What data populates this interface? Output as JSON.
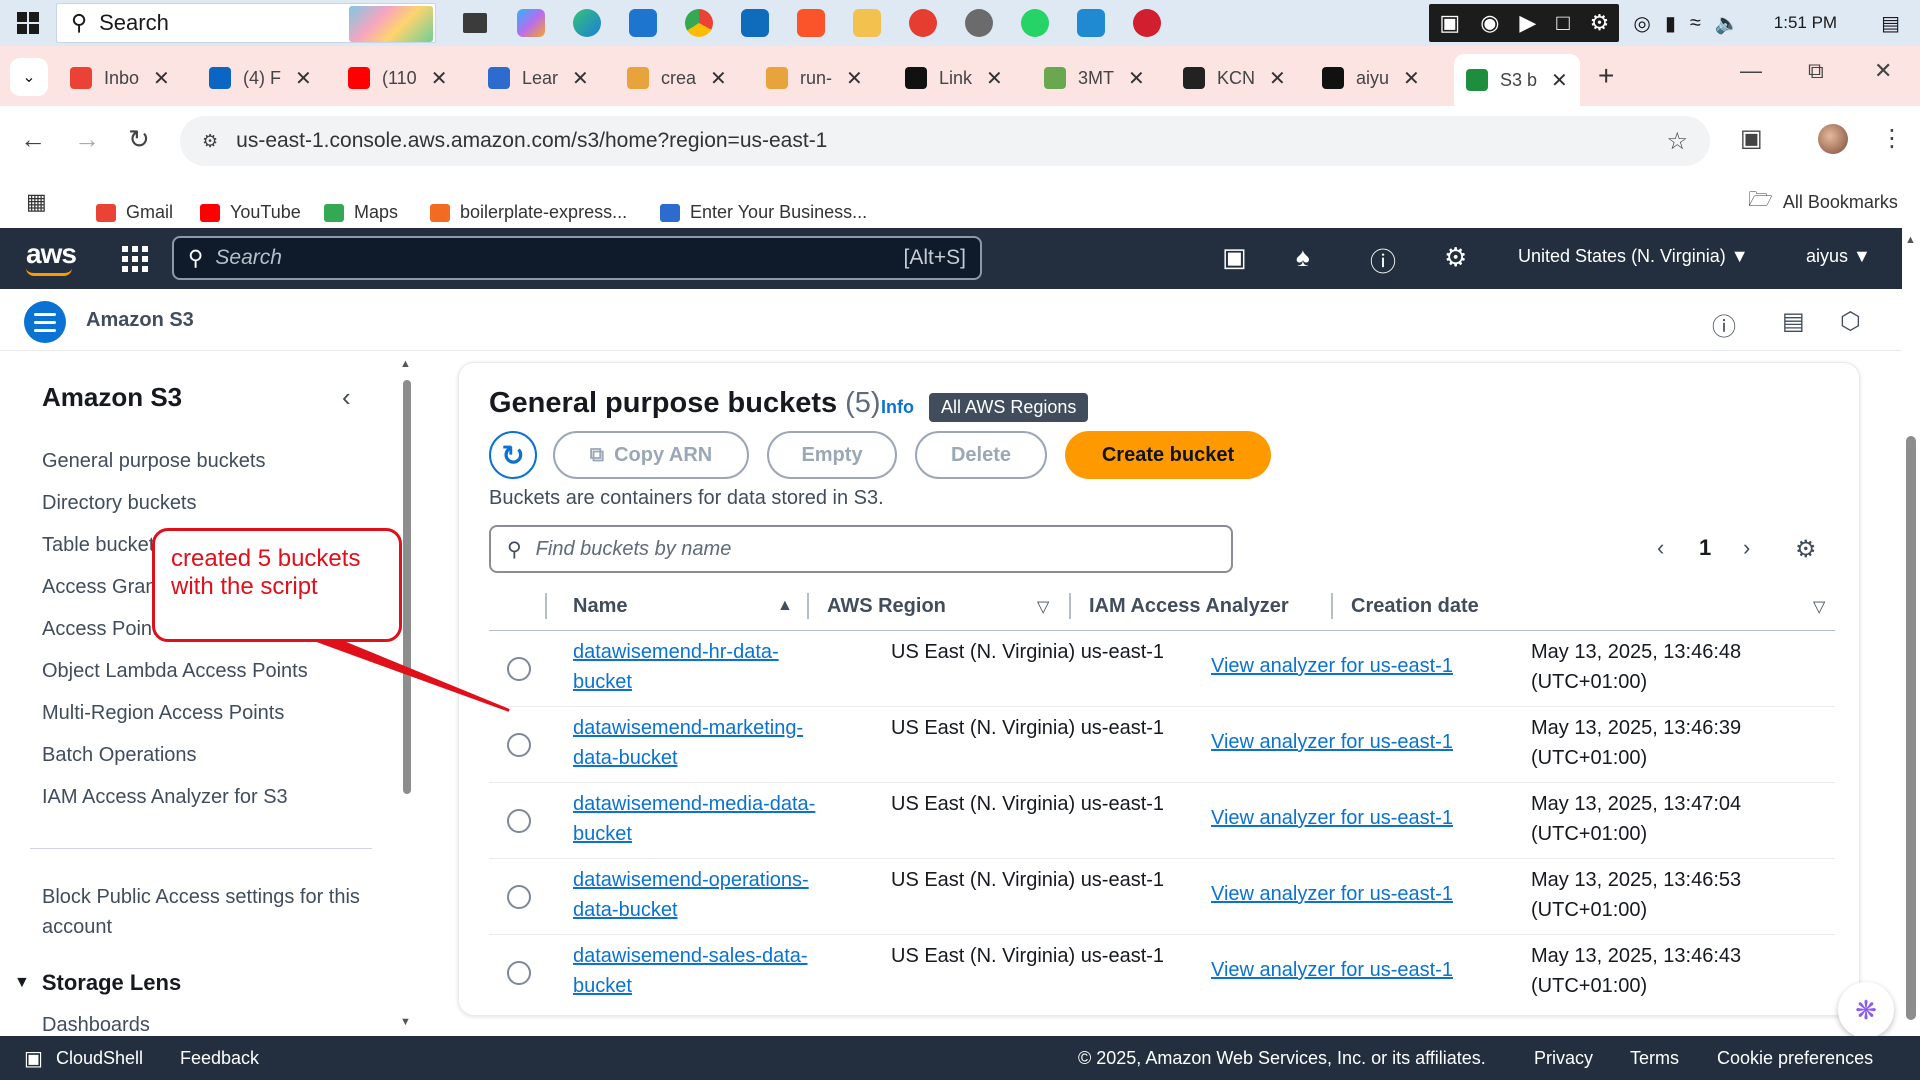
{
  "taskbar": {
    "search_placeholder": "Search",
    "clock": "1:51 PM"
  },
  "browser": {
    "tabs": [
      {
        "label": "Inbo",
        "color": "#ea4335"
      },
      {
        "label": "(4) F",
        "color": "#0a66c2"
      },
      {
        "label": "(110",
        "color": "#ff0000"
      },
      {
        "label": "Lear",
        "color": "#2d6bcf"
      },
      {
        "label": "crea",
        "color": "#e8a33d"
      },
      {
        "label": "run-",
        "color": "#e8a33d"
      },
      {
        "label": "Link",
        "color": "#111111"
      },
      {
        "label": "3MT",
        "color": "#6aa84f"
      },
      {
        "label": "KCN",
        "color": "#222222"
      },
      {
        "label": "aiyu",
        "color": "#111111"
      },
      {
        "label": "S3 b",
        "color": "#1e8e3e"
      }
    ],
    "url": "us-east-1.console.aws.amazon.com/s3/home?region=us-east-1",
    "bookmarks": [
      {
        "label": "Gmail",
        "color": "#ea4335"
      },
      {
        "label": "YouTube",
        "color": "#ff0000"
      },
      {
        "label": "Maps",
        "color": "#34a853"
      },
      {
        "label": "boilerplate-express...",
        "color": "#f26b21"
      },
      {
        "label": "Enter Your Business...",
        "color": "#2d6bcf"
      }
    ],
    "all_bookmarks": "All Bookmarks"
  },
  "aws_nav": {
    "logo": "aws",
    "search_placeholder": "Search",
    "shortcut": "[Alt+S]",
    "region": "United States (N. Virginia) ▼",
    "user": "aiyus ▼"
  },
  "service": {
    "title": "Amazon S3"
  },
  "sidebar": {
    "title": "Amazon S3",
    "items": [
      "General purpose buckets",
      "Directory buckets",
      "Table buckets",
      "Access Grants",
      "Access Points",
      "Object Lambda Access Points",
      "Multi-Region Access Points",
      "Batch Operations",
      "IAM Access Analyzer for S3"
    ],
    "block_public": "Block Public Access settings for this account",
    "section": "Storage Lens",
    "section_item": "Dashboards"
  },
  "annotation": {
    "text": "created 5 buckets with the script"
  },
  "panel": {
    "title": "General purpose buckets",
    "count": "(5)",
    "info": "Info",
    "badge": "All AWS Regions",
    "buttons": {
      "copy_arn": "Copy ARN",
      "empty": "Empty",
      "delete": "Delete",
      "create": "Create bucket"
    },
    "description": "Buckets are containers for data stored in S3.",
    "search_placeholder": "Find buckets by name",
    "page": "1",
    "columns": [
      "Name",
      "AWS Region",
      "IAM Access Analyzer",
      "Creation date"
    ],
    "rows": [
      {
        "name": "datawisemend-hr-data-bucket",
        "region": "US East (N. Virginia) us-east-1",
        "analyzer": "View analyzer for us-east-1",
        "date": "May 13, 2025, 13:46:48 (UTC+01:00)"
      },
      {
        "name": "datawisemend-marketing-data-bucket",
        "region": "US East (N. Virginia) us-east-1",
        "analyzer": "View analyzer for us-east-1",
        "date": "May 13, 2025, 13:46:39 (UTC+01:00)"
      },
      {
        "name": "datawisemend-media-data-bucket",
        "region": "US East (N. Virginia) us-east-1",
        "analyzer": "View analyzer for us-east-1",
        "date": "May 13, 2025, 13:47:04 (UTC+01:00)"
      },
      {
        "name": "datawisemend-operations-data-bucket",
        "region": "US East (N. Virginia) us-east-1",
        "analyzer": "View analyzer for us-east-1",
        "date": "May 13, 2025, 13:46:53 (UTC+01:00)"
      },
      {
        "name": "datawisemend-sales-data-bucket",
        "region": "US East (N. Virginia) us-east-1",
        "analyzer": "View analyzer for us-east-1",
        "date": "May 13, 2025, 13:46:43 (UTC+01:00)"
      }
    ]
  },
  "footer": {
    "cloudshell": "CloudShell",
    "feedback": "Feedback",
    "copyright": "© 2025, Amazon Web Services, Inc. or its affiliates.",
    "privacy": "Privacy",
    "terms": "Terms",
    "cookies": "Cookie preferences"
  }
}
